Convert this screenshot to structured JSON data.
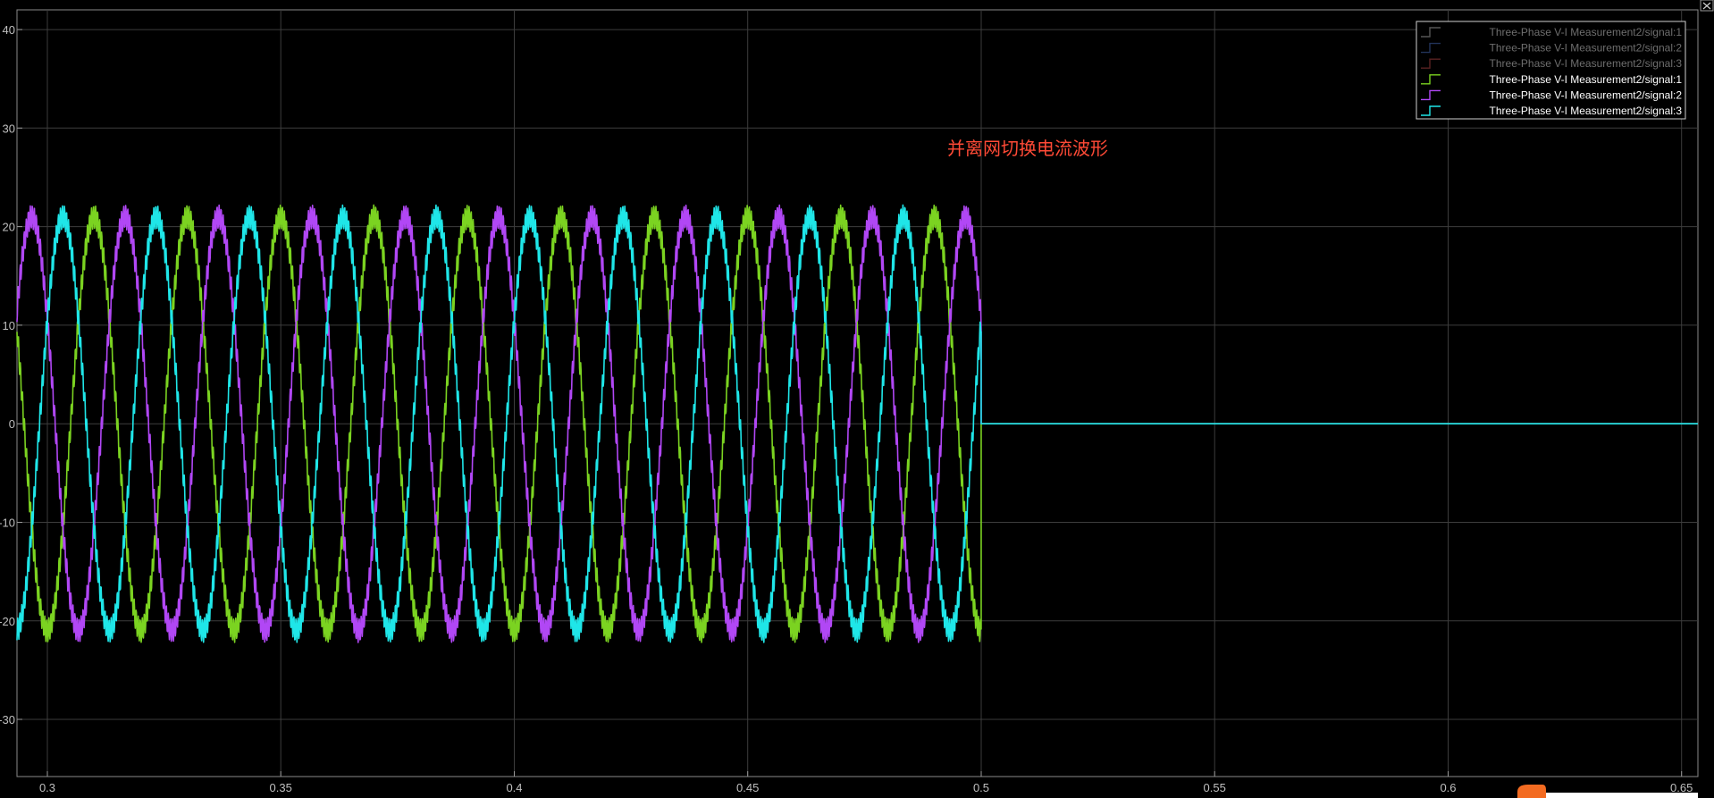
{
  "chart_data": {
    "type": "line",
    "title": "",
    "xlabel": "",
    "ylabel": "",
    "xlim": [
      0.2935,
      0.6535
    ],
    "ylim": [
      -35.8,
      42
    ],
    "x_ticks": [
      0.3,
      0.35,
      0.4,
      0.45,
      0.5,
      0.55,
      0.6,
      0.65
    ],
    "x_tick_labels": [
      "0.3",
      "0.35",
      "0.4",
      "0.45",
      "0.5",
      "0.55",
      "0.6",
      "0.65"
    ],
    "y_ticks": [
      -30,
      -20,
      -10,
      0,
      10,
      20,
      30,
      40
    ],
    "y_tick_labels": [
      "-30",
      "-20",
      "-10",
      "0",
      "10",
      "20",
      "30",
      "40"
    ],
    "grid": true,
    "legend_position": "top-right",
    "annotation": "并离网切换电流波形",
    "switch_time": 0.5,
    "frequency_hz": 50,
    "amplitude": 21,
    "ripple_amplitude": 1.2,
    "series": [
      {
        "name": "Three-Phase V-I Measurement2/signal:1",
        "color": "#555555",
        "legend_text_color": "#6e6e6e",
        "visible": false,
        "phase_deg": 0
      },
      {
        "name": "Three-Phase V-I Measurement2/signal:2",
        "color": "#22335a",
        "legend_text_color": "#6e6e6e",
        "visible": false,
        "phase_deg": -120
      },
      {
        "name": "Three-Phase V-I Measurement2/signal:3",
        "color": "#5a2222",
        "legend_text_color": "#6e6e6e",
        "visible": false,
        "phase_deg": 120
      },
      {
        "name": "Three-Phase V-I Measurement2/signal:1",
        "color": "#7bd321",
        "legend_text_color": "#ffffff",
        "visible": true,
        "phase_deg": -90
      },
      {
        "name": "Three-Phase V-I Measurement2/signal:2",
        "color": "#b147f5",
        "legend_text_color": "#ffffff",
        "visible": true,
        "phase_deg": 150
      },
      {
        "name": "Three-Phase V-I Measurement2/signal:3",
        "color": "#1fe6e8",
        "legend_text_color": "#ffffff",
        "visible": true,
        "phase_deg": 30
      }
    ]
  }
}
